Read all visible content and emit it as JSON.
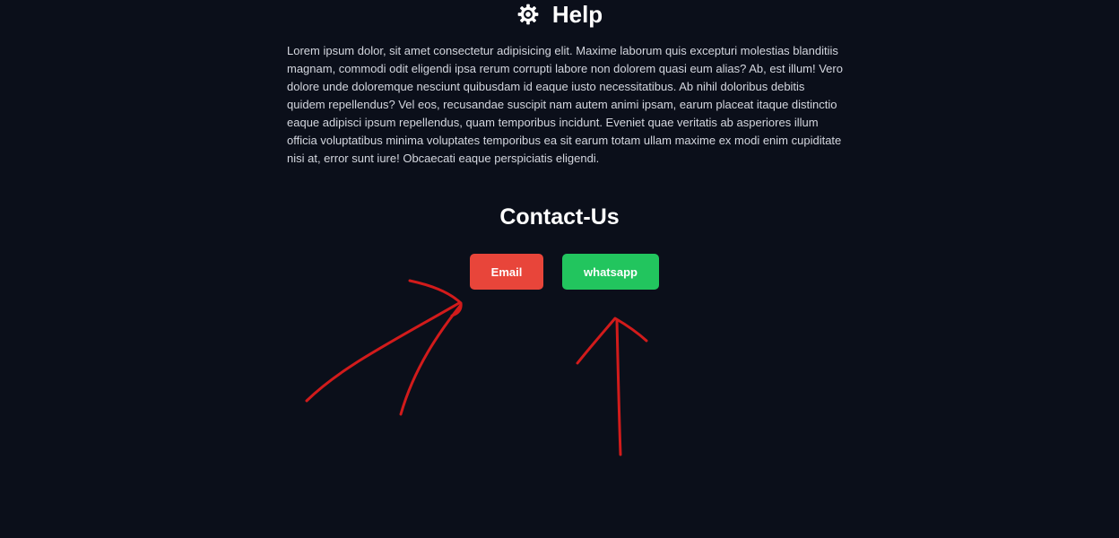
{
  "help": {
    "icon": "gear-icon",
    "title": "Help",
    "body": "Lorem ipsum dolor, sit amet consectetur adipisicing elit. Maxime laborum quis excepturi molestias blanditiis magnam, commodi odit eligendi ipsa rerum corrupti labore non dolorem quasi eum alias? Ab, est illum! Vero dolore unde doloremque nesciunt quibusdam id eaque iusto necessitatibus. Ab nihil doloribus debitis quidem repellendus? Vel eos, recusandae suscipit nam autem animi ipsam, earum placeat itaque distinctio eaque adipisci ipsum repellendus, quam temporibus incidunt. Eveniet quae veritatis ab asperiores illum officia voluptatibus minima voluptates temporibus ea sit earum totam ullam maxime ex modi enim cupiditate nisi at, error sunt iure! Obcaecati eaque perspiciatis eligendi."
  },
  "contact": {
    "title": "Contact-Us",
    "email_label": "Email",
    "whatsapp_label": "whatsapp"
  },
  "colors": {
    "background": "#0b0f1a",
    "email_button": "#e8453a",
    "whatsapp_button": "#22c55e",
    "annotation": "#d21b1b"
  }
}
